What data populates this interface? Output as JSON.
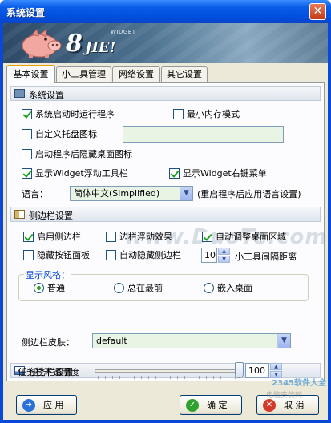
{
  "window": {
    "title": "系统设置",
    "close_glyph": "✕"
  },
  "banner": {
    "logo_8": "8",
    "logo_jie": "JIE!",
    "logo_widget": "WIDGET"
  },
  "tabs": [
    {
      "label": "基本设置",
      "active": true
    },
    {
      "label": "小工具管理",
      "active": false
    },
    {
      "label": "网络设置",
      "active": false
    },
    {
      "label": "其它设置",
      "active": false
    }
  ],
  "system": {
    "title": "系统设置",
    "run_on_startup": {
      "label": "系统启动时运行程序",
      "checked": true
    },
    "min_memory": {
      "label": "最小内存模式",
      "checked": false
    },
    "custom_tray": {
      "label": "自定义托盘图标",
      "checked": false,
      "value": ""
    },
    "hide_desktop_icons": {
      "label": "启动程序后隐藏桌面图标",
      "checked": false
    },
    "show_widget_toolbar": {
      "label": "显示Widget浮动工具栏",
      "checked": true
    },
    "show_widget_menu": {
      "label": "显示Widget右键菜单",
      "checked": true
    },
    "language_label": "语言：",
    "language_value": "简体中文(Simplified)",
    "language_note": "(重启程序后应用语言设置)"
  },
  "sidebar": {
    "title": "侧边栏设置",
    "enable_sidebar": {
      "label": "启用侧边栏",
      "checked": true
    },
    "float_effect": {
      "label": "边栏浮动效果",
      "checked": false
    },
    "auto_adjust": {
      "label": "自动调整桌面区域",
      "checked": true
    },
    "hide_panel": {
      "label": "隐藏按钮面板",
      "checked": false
    },
    "auto_hide": {
      "label": "自动隐藏侧边栏",
      "checked": false
    },
    "spacing_value": "10",
    "spacing_label": "小工具间隔距离",
    "style_legend": "显示风格：",
    "styles": [
      {
        "label": "普通",
        "checked": true
      },
      {
        "label": "总在最前",
        "checked": false
      },
      {
        "label": "嵌入桌面",
        "checked": false
      }
    ],
    "skin_label": "侧边栏皮肤：",
    "skin_value": "default"
  },
  "taskbar": {
    "title": "任务栏设置",
    "opacity_label": "任务栏不透明度",
    "opacity_value": "100",
    "opacity_fraction": 1.0
  },
  "buttons": {
    "apply": "应 用",
    "ok": "确 定",
    "cancel": "取 消"
  },
  "watermarks": {
    "center": "www.DuoTe.com",
    "corner": "2345软件大全",
    "corner2": "电脑安装网"
  },
  "icons": {
    "dropdown": "▼",
    "spin_up": "▲",
    "spin_down": "▼",
    "apply_icon": "arrow-icon",
    "ok_icon": "check-icon",
    "cancel_icon": "x-icon"
  },
  "colors": {
    "title_bar": "#0050e0",
    "accent_tab": "#e8a100",
    "group_legend": "#0046d5",
    "field_bg": "#e9f5e4"
  }
}
